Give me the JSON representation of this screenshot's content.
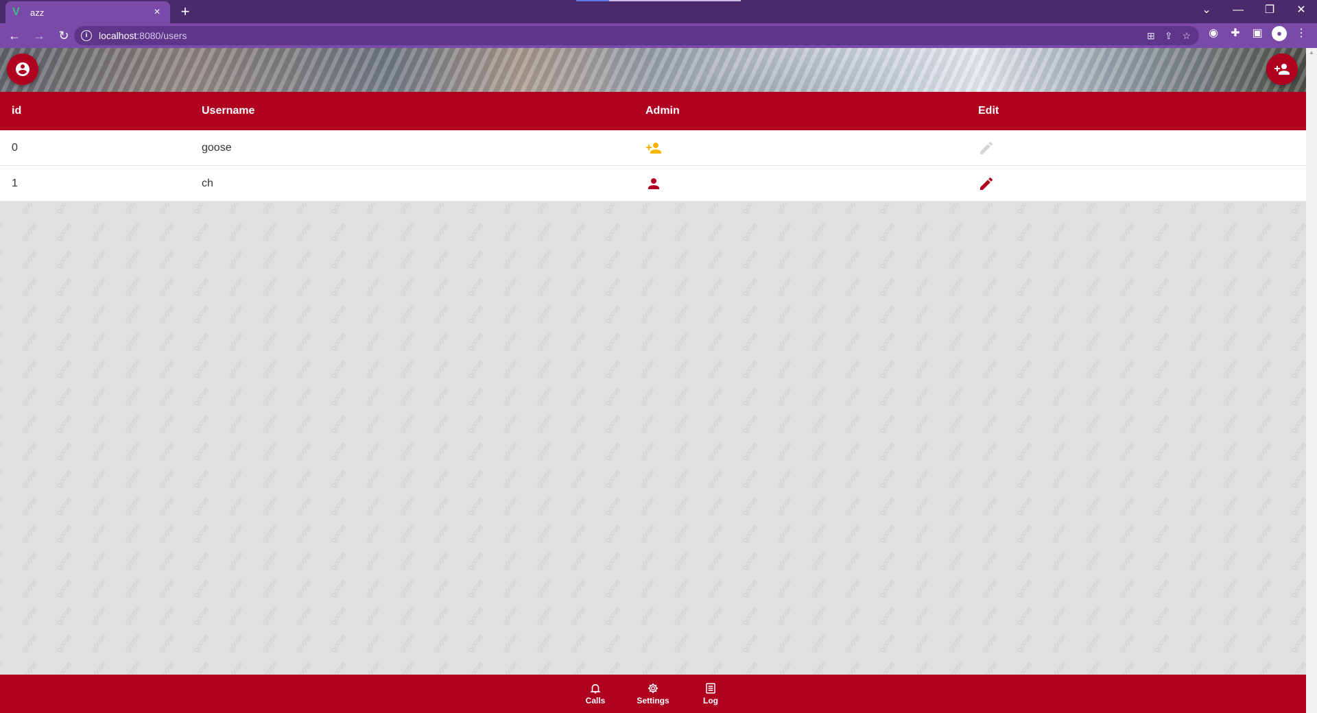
{
  "browser": {
    "tab_title": "azz",
    "tab_close": "×",
    "new_tab": "+",
    "url_host": "localhost",
    "url_path": ":8080/users",
    "win_controls": [
      "⌄",
      "—",
      "❐",
      "✕"
    ],
    "nav": {
      "back": "←",
      "forward": "→",
      "reload": "↻"
    }
  },
  "app": {
    "header_actions": {
      "account_icon": "account-circle-icon",
      "add_user_icon": "person-add-icon"
    },
    "table": {
      "headers": {
        "id": "id",
        "username": "Username",
        "admin": "Admin",
        "edit": "Edit"
      },
      "rows": [
        {
          "id": "0",
          "username": "goose",
          "admin_icon": "person-add-icon",
          "admin_color": "#f5b400",
          "edit_color": "#cfcfcf"
        },
        {
          "id": "1",
          "username": "ch",
          "admin_icon": "person-icon",
          "admin_color": "#b00020",
          "edit_color": "#b00020"
        }
      ]
    },
    "watermark_text": "goose",
    "bottom_nav": [
      {
        "label": "Calls",
        "icon": "bell-icon"
      },
      {
        "label": "Settings",
        "icon": "gear-icon"
      },
      {
        "label": "Log",
        "icon": "log-icon"
      }
    ],
    "colors": {
      "primary": "#b00020",
      "browser": "#7a4aa8"
    }
  }
}
